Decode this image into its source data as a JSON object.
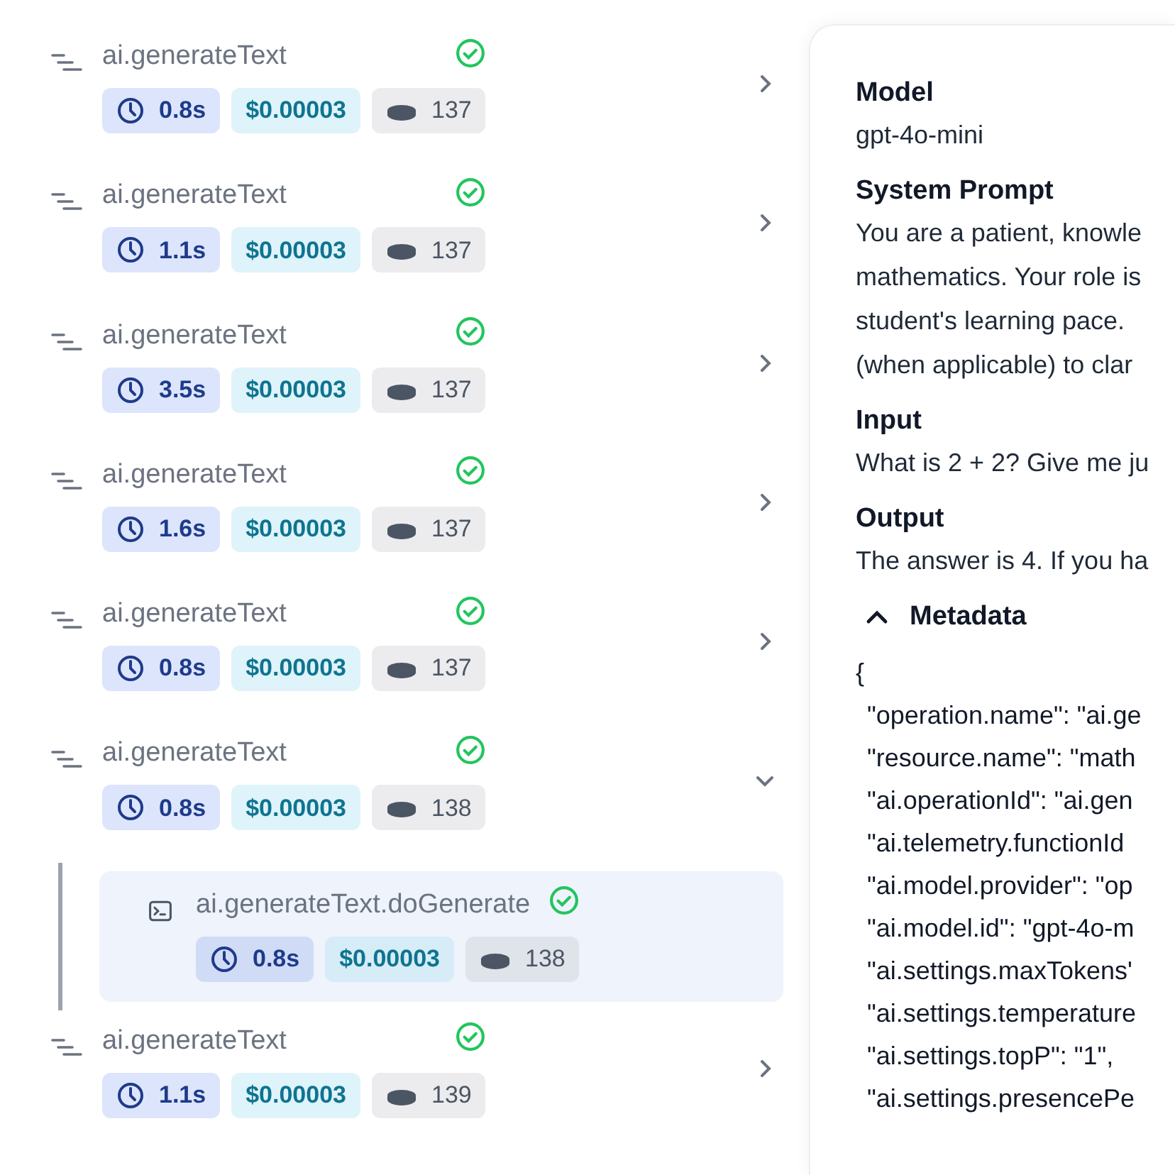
{
  "spans": [
    {
      "name": "ai.generateText",
      "kind": "call",
      "succeeded": true,
      "duration": "0.8s",
      "cost": "$0.00003",
      "tokens": "137",
      "expanded": false
    },
    {
      "name": "ai.generateText",
      "kind": "call",
      "succeeded": true,
      "duration": "1.1s",
      "cost": "$0.00003",
      "tokens": "137",
      "expanded": false
    },
    {
      "name": "ai.generateText",
      "kind": "call",
      "succeeded": true,
      "duration": "3.5s",
      "cost": "$0.00003",
      "tokens": "137",
      "expanded": false
    },
    {
      "name": "ai.generateText",
      "kind": "call",
      "succeeded": true,
      "duration": "1.6s",
      "cost": "$0.00003",
      "tokens": "137",
      "expanded": false
    },
    {
      "name": "ai.generateText",
      "kind": "call",
      "succeeded": true,
      "duration": "0.8s",
      "cost": "$0.00003",
      "tokens": "137",
      "expanded": false
    },
    {
      "name": "ai.generateText",
      "kind": "call",
      "succeeded": true,
      "duration": "0.8s",
      "cost": "$0.00003",
      "tokens": "138",
      "expanded": true,
      "children": [
        {
          "name": "ai.generateText.doGenerate",
          "kind": "generation",
          "succeeded": true,
          "duration": "0.8s",
          "cost": "$0.00003",
          "tokens": "138",
          "selected": true
        }
      ]
    },
    {
      "name": "ai.generateText",
      "kind": "call",
      "succeeded": true,
      "duration": "1.1s",
      "cost": "$0.00003",
      "tokens": "139",
      "expanded": false
    }
  ],
  "details": {
    "sections": [
      {
        "label": "Model",
        "value": "gpt-4o-mini"
      },
      {
        "label": "System Prompt",
        "lines": [
          "You are a patient, knowle",
          "mathematics. Your role is",
          "student's learning pace.",
          "(when applicable) to clar"
        ]
      },
      {
        "label": "Input",
        "value": "What is 2 + 2? Give me ju"
      },
      {
        "label": "Output",
        "value": "The answer is 4. If you ha"
      }
    ],
    "metadata": {
      "label": "Metadata",
      "expanded": true,
      "open": "{",
      "entries": [
        "\"operation.name\": \"ai.ge",
        "\"resource.name\": \"math",
        "\"ai.operationId\": \"ai.gen",
        "\"ai.telemetry.functionId",
        "\"ai.model.provider\": \"op",
        "\"ai.model.id\": \"gpt-4o-m",
        "\"ai.settings.maxTokens'",
        "\"ai.settings.temperature",
        "\"ai.settings.topP\": \"1\",",
        "\"ai.settings.presencePe"
      ]
    }
  }
}
